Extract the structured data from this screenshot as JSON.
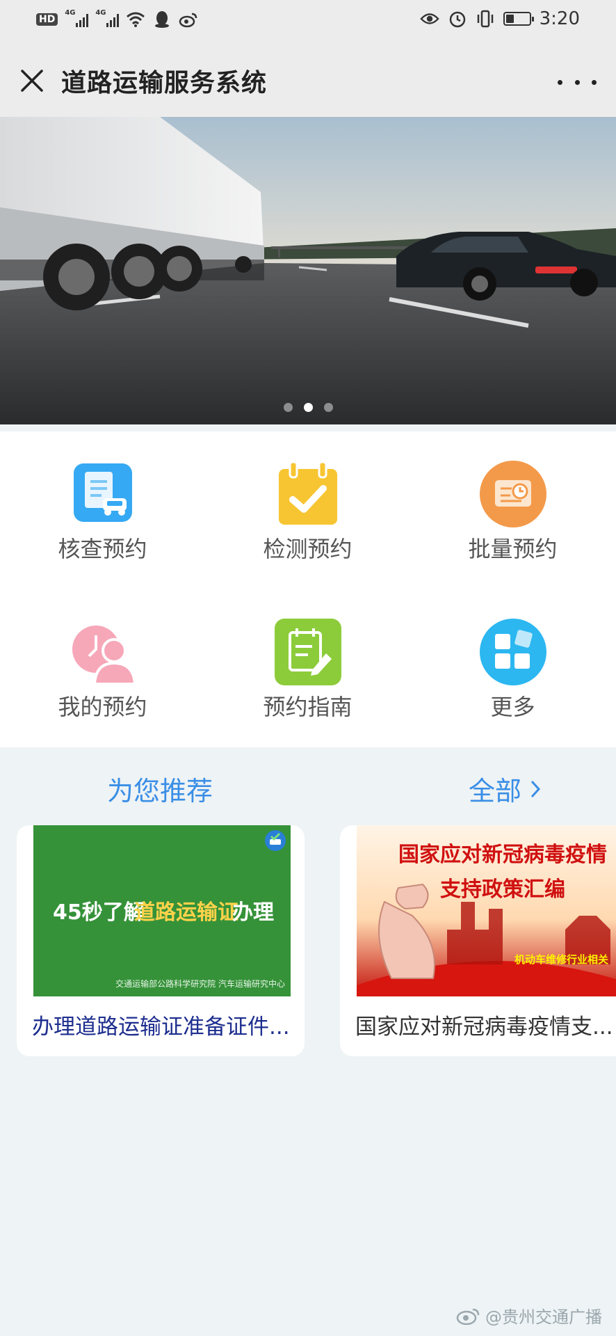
{
  "status_bar": {
    "hd": "HD",
    "net1": "4G",
    "net2": "4G",
    "time": "3:20",
    "battery_level": 0.35
  },
  "nav": {
    "title": "道路运输服务系统"
  },
  "banner": {
    "slides": 3,
    "active_slide": 2
  },
  "grid": [
    {
      "label": "核查预约",
      "icon": "document-car-icon",
      "color": "#35a9f3"
    },
    {
      "label": "检测预约",
      "icon": "calendar-check-icon",
      "color": "#f7c531"
    },
    {
      "label": "批量预约",
      "icon": "schedule-clock-icon",
      "color": "#f39a4a"
    },
    {
      "label": "我的预约",
      "icon": "user-clock-icon",
      "color": "#f6a7b8"
    },
    {
      "label": "预约指南",
      "icon": "guide-pen-icon",
      "color": "#8ccc3b"
    },
    {
      "label": "更多",
      "icon": "apps-grid-icon",
      "color": "#2cb7f0"
    }
  ],
  "recommend": {
    "title": "为您推荐",
    "all_label": "全部",
    "cards": [
      {
        "caption": "办理道路运输证准备证件...",
        "image_headline_a": "45秒了解",
        "image_headline_b": "道路运输证",
        "image_headline_c": "办理",
        "image_footer": "交通运输部公路科学研究院 汽车运输研究中心"
      },
      {
        "caption": "国家应对新冠病毒疫情支...",
        "image_title_1": "国家应对新冠病毒疫情",
        "image_title_2": "支持政策汇编",
        "image_tag": "机动车维修行业相关"
      }
    ]
  },
  "watermark": "@贵州交通广播"
}
